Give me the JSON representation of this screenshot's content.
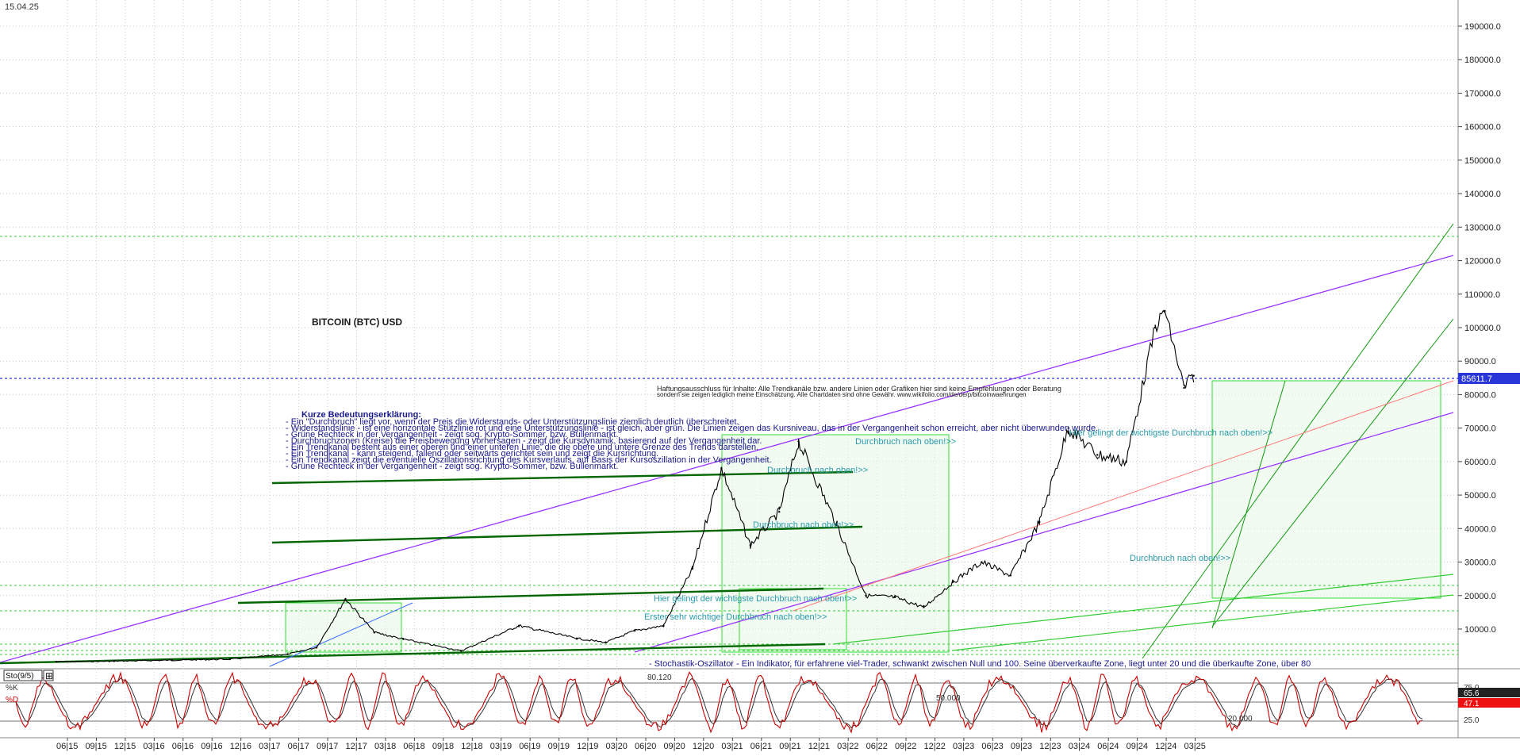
{
  "header": {
    "date": "15.04.25"
  },
  "chart_data": {
    "type": "line",
    "title": "BITCOIN (BTC) USD",
    "price_axis": {
      "ticks": [
        "190000.0",
        "180000.0",
        "170000.0",
        "160000.0",
        "150000.0",
        "140000.0",
        "130000.0",
        "120000.0",
        "110000.0",
        "100000.0",
        "90000.0",
        "80000.0",
        "70000.0",
        "60000.0",
        "50000.0",
        "40000.0",
        "30000.0",
        "20000.0",
        "10000.0"
      ],
      "ylim": [
        0,
        195000
      ]
    },
    "last_price": "85611.7",
    "time_labels": [
      "06|15",
      "09|15",
      "12|15",
      "03|16",
      "06|16",
      "09|16",
      "12|16",
      "03|17",
      "06|17",
      "09|17",
      "12|17",
      "03|18",
      "06|18",
      "09|18",
      "12|18",
      "03|19",
      "06|19",
      "09|19",
      "12|19",
      "03|20",
      "06|20",
      "09|20",
      "12|20",
      "03|21",
      "06|21",
      "09|21",
      "12|21",
      "03|22",
      "06|22",
      "09|22",
      "12|22",
      "03|23",
      "06|23",
      "09|23",
      "12|23",
      "03|24",
      "06|24",
      "09|24",
      "12|24",
      "03|25"
    ],
    "series": [
      {
        "name": "",
        "x": [
          "06|15",
          "12|15",
          "06|16",
          "12|16",
          "06|17",
          "09|17",
          "12|17",
          "03|18",
          "06|18",
          "12|18",
          "06|19",
          "12|19",
          "03|20",
          "06|20",
          "09|20",
          "12|20",
          "03|21",
          "06|21",
          "09|21",
          "11|21",
          "03|22",
          "06|22",
          "09|22",
          "12|22",
          "03|23",
          "06|23",
          "09|23",
          "12|23",
          "03|24",
          "06|24",
          "09|24",
          "12|24",
          "01|25",
          "03|25",
          "04|25"
        ],
        "values": [
          230,
          430,
          700,
          1000,
          2500,
          4500,
          19000,
          9000,
          7000,
          3500,
          11000,
          7200,
          6000,
          9500,
          11000,
          28000,
          58000,
          35000,
          45000,
          66000,
          41000,
          20000,
          19500,
          16500,
          24000,
          30000,
          26000,
          42000,
          70000,
          62000,
          60000,
          100000,
          105000,
          82000,
          85611.7
        ]
      }
    ],
    "notes": {
      "disclaimer_1": "Haftungsausschluss für Inhalte: Alle Trendkanäle bzw. andere Linien oder Grafiken hier sind keine Empfehlungen oder Beratung",
      "disclaimer_2": "sondern sie zeigen lediglich meine Einschätzung. Alle Chartdaten sind ohne Gewähr. www.wikifolio.com/de/de/p/bitcoinwaehrungen",
      "explanation_title": "Kurze Bedeutungserklärung:",
      "explanation_lines": [
        "- Ein \"Durchbruch\" liegt vor, wenn der Preis die Widerstands- oder Unterstützungslinie ziemlich deutlich überschreitet.",
        "- Widerstandslinie - ist eine horizontale Stützlinie rot und eine Unterstützungslinie - ist gleich, aber grün. Die Linien zeigen das Kursniveau, das in der Vergangenheit schon erreicht, aber nicht überwunden wurde.",
        "- Grüne Rechteck in der Vergangenheit - zeigt sog. Krypto-Sommer, bzw. Bullenmarkt.",
        "- Durchbruchzonen (Kreise) die Preisbewegung vorhersagen - zeigt die Kursdynamik, basierend auf der Vergangenheit dar.",
        "- Ein Trendkanal besteht aus einer oberen und einer unteren Linie, die die obere und untere Grenze des Trends darstellen.",
        "- Ein Trendkanal - kann steigend, fallend oder seitwärts gerichtet sein und zeigt die Kursrichtung.",
        "- Ein Trendkanal zeigt die eventuelle Oszillationsrichtung des Kursverlaufs, auf Basis der Kursoszillation in der Vergangenheit.",
        "- Grüne Rechteck in der Vergangenheit - zeigt sog. Krypto-Sommer, bzw. Bullenmarkt."
      ],
      "breakout_1": "Durchbruch nach oben!>>",
      "breakout_2": "Durchbruch nach oben!>>",
      "breakout_3": "Durchbruch nach oben!>>",
      "breakout_4": "Durchbruch nach oben!>>",
      "first_breakout": "Erster sehr wichtiger Durchbruch nach oben!>>",
      "important_breakout_1": "Hier gelingt der wichtigste Durchbruch nach oben!>>",
      "important_breakout_2": "Hier gelingt der wichtigste Durchbruch nach oben!>>",
      "stochastic_note": "- Stochastik-Oszillator - Ein Indikator, für erfahrene viel-Trader, schwankt zwischen Null und 100. Seine überverkaufte Zone, liegt unter 20 und die überkaufte Zone, über 80"
    },
    "indicator": {
      "name": "Sto(9/5)",
      "k_label": "%K",
      "d_label": "%D",
      "ticks": [
        "75.0",
        "25.0"
      ],
      "level_80_label": "80.120",
      "level_50_label": "50.000",
      "level_20_label": "20.000",
      "k_value": "65.6",
      "d_value": "47.1"
    },
    "colors": {
      "price": "#000000",
      "resistance": "#ff0000",
      "support": "#00aa00",
      "channel": "#9933ff",
      "trend": "#006600",
      "last_price_bg": "#2a37d8",
      "notes_text": "#1a1a8c",
      "breakout_text": "#2a9aaa",
      "stoch_k": "#cc0000",
      "stoch_d": "#333333"
    }
  }
}
